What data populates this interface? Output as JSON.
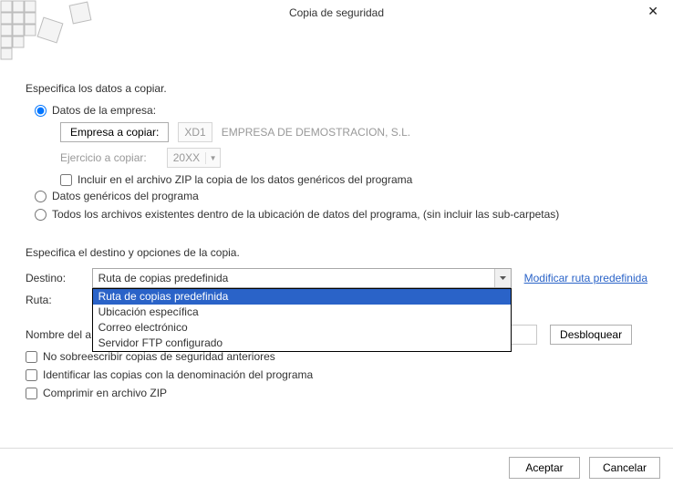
{
  "title": "Copia de seguridad",
  "section1_label": "Especifica los datos a copiar.",
  "radios": {
    "company": "Datos de la empresa:",
    "generic": "Datos genéricos del programa",
    "all": "Todos los archivos existentes dentro de la ubicación de datos del programa, (sin incluir las sub-carpetas)"
  },
  "company": {
    "button": "Empresa a copiar:",
    "code": "XD1",
    "name": "EMPRESA DE DEMOSTRACION, S.L.",
    "year_label": "Ejercicio a copiar:",
    "year_value": "20XX"
  },
  "include_generic": "Incluir en el archivo ZIP la copia de los datos genéricos del programa",
  "section2_label": "Especifica el destino y opciones de la copia.",
  "destino_label": "Destino:",
  "ruta_label": "Ruta:",
  "name_label": "Nombre del a",
  "combo_value": "Ruta de copias predefinida",
  "combo_options": [
    "Ruta de copias predefinida",
    "Ubicación específica",
    "Correo electrónico",
    "Servidor FTP configurado"
  ],
  "mod_link": "Modificar ruta predefinida",
  "desbloquear": "Desbloquear",
  "checks": {
    "overwrite": "No sobreescribir copias de seguridad anteriores",
    "identify": "Identificar las copias con la denominación del programa",
    "zip": "Comprimir en archivo ZIP"
  },
  "footer": {
    "accept": "Aceptar",
    "cancel": "Cancelar"
  }
}
